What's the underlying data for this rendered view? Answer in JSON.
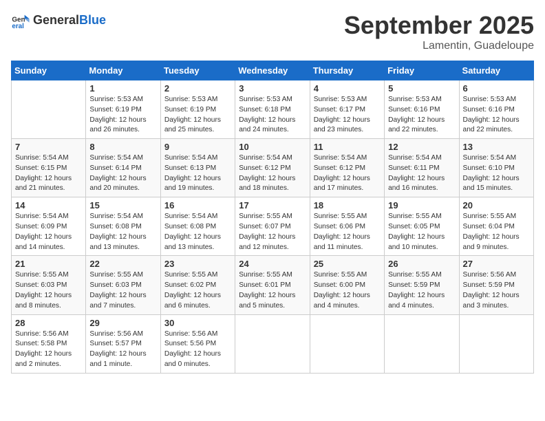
{
  "header": {
    "logo_general": "General",
    "logo_blue": "Blue",
    "month_title": "September 2025",
    "location": "Lamentin, Guadeloupe"
  },
  "days_of_week": [
    "Sunday",
    "Monday",
    "Tuesday",
    "Wednesday",
    "Thursday",
    "Friday",
    "Saturday"
  ],
  "weeks": [
    [
      {
        "day": "",
        "info": ""
      },
      {
        "day": "1",
        "info": "Sunrise: 5:53 AM\nSunset: 6:19 PM\nDaylight: 12 hours\nand 26 minutes."
      },
      {
        "day": "2",
        "info": "Sunrise: 5:53 AM\nSunset: 6:19 PM\nDaylight: 12 hours\nand 25 minutes."
      },
      {
        "day": "3",
        "info": "Sunrise: 5:53 AM\nSunset: 6:18 PM\nDaylight: 12 hours\nand 24 minutes."
      },
      {
        "day": "4",
        "info": "Sunrise: 5:53 AM\nSunset: 6:17 PM\nDaylight: 12 hours\nand 23 minutes."
      },
      {
        "day": "5",
        "info": "Sunrise: 5:53 AM\nSunset: 6:16 PM\nDaylight: 12 hours\nand 22 minutes."
      },
      {
        "day": "6",
        "info": "Sunrise: 5:53 AM\nSunset: 6:16 PM\nDaylight: 12 hours\nand 22 minutes."
      }
    ],
    [
      {
        "day": "7",
        "info": "Sunrise: 5:54 AM\nSunset: 6:15 PM\nDaylight: 12 hours\nand 21 minutes."
      },
      {
        "day": "8",
        "info": "Sunrise: 5:54 AM\nSunset: 6:14 PM\nDaylight: 12 hours\nand 20 minutes."
      },
      {
        "day": "9",
        "info": "Sunrise: 5:54 AM\nSunset: 6:13 PM\nDaylight: 12 hours\nand 19 minutes."
      },
      {
        "day": "10",
        "info": "Sunrise: 5:54 AM\nSunset: 6:12 PM\nDaylight: 12 hours\nand 18 minutes."
      },
      {
        "day": "11",
        "info": "Sunrise: 5:54 AM\nSunset: 6:12 PM\nDaylight: 12 hours\nand 17 minutes."
      },
      {
        "day": "12",
        "info": "Sunrise: 5:54 AM\nSunset: 6:11 PM\nDaylight: 12 hours\nand 16 minutes."
      },
      {
        "day": "13",
        "info": "Sunrise: 5:54 AM\nSunset: 6:10 PM\nDaylight: 12 hours\nand 15 minutes."
      }
    ],
    [
      {
        "day": "14",
        "info": "Sunrise: 5:54 AM\nSunset: 6:09 PM\nDaylight: 12 hours\nand 14 minutes."
      },
      {
        "day": "15",
        "info": "Sunrise: 5:54 AM\nSunset: 6:08 PM\nDaylight: 12 hours\nand 13 minutes."
      },
      {
        "day": "16",
        "info": "Sunrise: 5:54 AM\nSunset: 6:08 PM\nDaylight: 12 hours\nand 13 minutes."
      },
      {
        "day": "17",
        "info": "Sunrise: 5:55 AM\nSunset: 6:07 PM\nDaylight: 12 hours\nand 12 minutes."
      },
      {
        "day": "18",
        "info": "Sunrise: 5:55 AM\nSunset: 6:06 PM\nDaylight: 12 hours\nand 11 minutes."
      },
      {
        "day": "19",
        "info": "Sunrise: 5:55 AM\nSunset: 6:05 PM\nDaylight: 12 hours\nand 10 minutes."
      },
      {
        "day": "20",
        "info": "Sunrise: 5:55 AM\nSunset: 6:04 PM\nDaylight: 12 hours\nand 9 minutes."
      }
    ],
    [
      {
        "day": "21",
        "info": "Sunrise: 5:55 AM\nSunset: 6:03 PM\nDaylight: 12 hours\nand 8 minutes."
      },
      {
        "day": "22",
        "info": "Sunrise: 5:55 AM\nSunset: 6:03 PM\nDaylight: 12 hours\nand 7 minutes."
      },
      {
        "day": "23",
        "info": "Sunrise: 5:55 AM\nSunset: 6:02 PM\nDaylight: 12 hours\nand 6 minutes."
      },
      {
        "day": "24",
        "info": "Sunrise: 5:55 AM\nSunset: 6:01 PM\nDaylight: 12 hours\nand 5 minutes."
      },
      {
        "day": "25",
        "info": "Sunrise: 5:55 AM\nSunset: 6:00 PM\nDaylight: 12 hours\nand 4 minutes."
      },
      {
        "day": "26",
        "info": "Sunrise: 5:55 AM\nSunset: 5:59 PM\nDaylight: 12 hours\nand 4 minutes."
      },
      {
        "day": "27",
        "info": "Sunrise: 5:56 AM\nSunset: 5:59 PM\nDaylight: 12 hours\nand 3 minutes."
      }
    ],
    [
      {
        "day": "28",
        "info": "Sunrise: 5:56 AM\nSunset: 5:58 PM\nDaylight: 12 hours\nand 2 minutes."
      },
      {
        "day": "29",
        "info": "Sunrise: 5:56 AM\nSunset: 5:57 PM\nDaylight: 12 hours\nand 1 minute."
      },
      {
        "day": "30",
        "info": "Sunrise: 5:56 AM\nSunset: 5:56 PM\nDaylight: 12 hours\nand 0 minutes."
      },
      {
        "day": "",
        "info": ""
      },
      {
        "day": "",
        "info": ""
      },
      {
        "day": "",
        "info": ""
      },
      {
        "day": "",
        "info": ""
      }
    ]
  ]
}
